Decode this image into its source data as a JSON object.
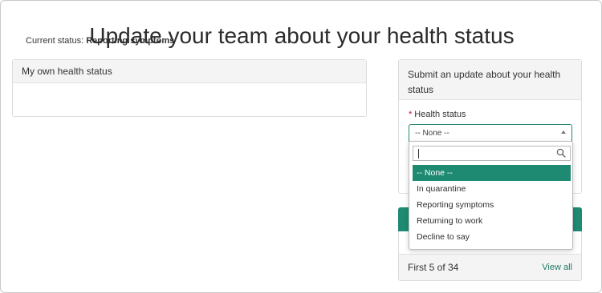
{
  "page": {
    "title": "Update your team about your health status"
  },
  "own_status": {
    "header": "My own health status",
    "current_label": "Current status:",
    "current_value": "Reporting symptoms"
  },
  "submit_update": {
    "header": "Submit an update about your health status",
    "field_label": "Health status",
    "required_mark": "*",
    "selected_value": "-- None --"
  },
  "dropdown": {
    "search_placeholder": "",
    "options": [
      "-- None --",
      "In quarantine",
      "Reporting symptoms",
      "Returning to work",
      "Decline to say"
    ],
    "selected_index": 0
  },
  "lower_card": {
    "count_text": "First 5 of 34",
    "view_all_label": "View all",
    "accent_color": "#1f8a72"
  },
  "colors": {
    "accent": "#1f8a72",
    "required": "#c8102e"
  },
  "icons": {
    "search": "search-icon",
    "caret": "caret-up-icon"
  }
}
